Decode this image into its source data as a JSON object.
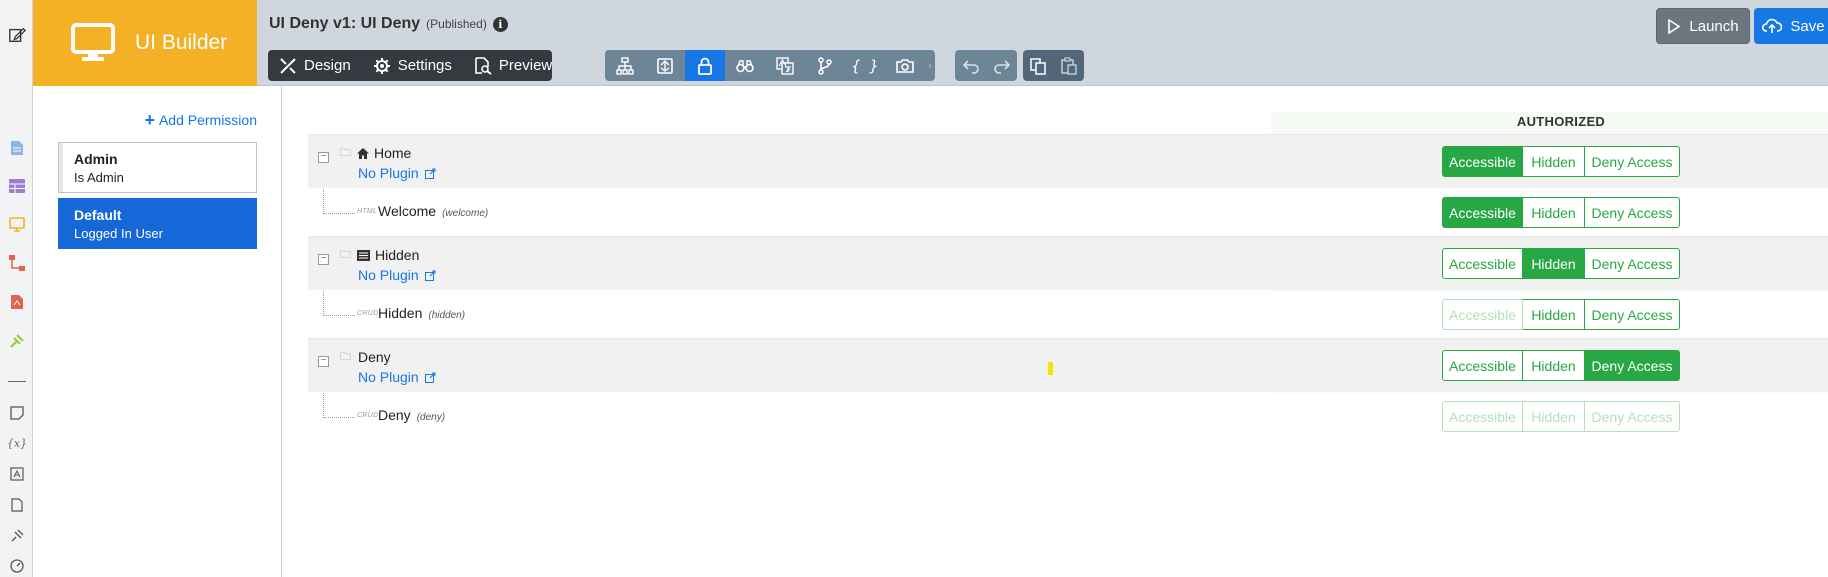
{
  "brand": {
    "title": "UI Builder"
  },
  "app": {
    "title": "UI Deny v1: UI Deny",
    "status": "(Published)"
  },
  "modes": [
    {
      "label": "Design",
      "icon": "design-icon"
    },
    {
      "label": "Settings",
      "icon": "gear-icon"
    },
    {
      "label": "Preview",
      "icon": "preview-icon"
    }
  ],
  "toolbar": {
    "tools": [
      "sitemap-icon",
      "upload-icon",
      "lock-icon",
      "binoculars-icon",
      "translate-icon",
      "branch-icon",
      "braces-icon",
      "camera-icon"
    ],
    "active_tool": "lock-icon"
  },
  "actions": {
    "launch": "Launch",
    "save": "Save"
  },
  "permissions": {
    "add_label": "Add Permission",
    "items": [
      {
        "name": "Admin",
        "sub": "Is Admin"
      },
      {
        "name": "Default",
        "sub": "Logged In User",
        "selected": true
      }
    ]
  },
  "main": {
    "column_header": "AUTHORIZED",
    "no_plugin": "No Plugin",
    "state_labels": {
      "accessible": "Accessible",
      "hidden": "Hidden",
      "deny": "Deny Access"
    },
    "rows": [
      {
        "kind": "page",
        "name": "Home",
        "icon": "home-icon",
        "state": "accessible"
      },
      {
        "kind": "component",
        "type": "HTML",
        "name": "Welcome",
        "id": "(welcome)",
        "state": "accessible"
      },
      {
        "kind": "page",
        "name": "Hidden",
        "icon": "list-icon",
        "state": "hidden"
      },
      {
        "kind": "component",
        "type": "CRUD",
        "name": "Hidden",
        "id": "(hidden)",
        "state": "hidden",
        "disabled": [
          "accessible"
        ]
      },
      {
        "kind": "page",
        "name": "Deny",
        "state": "deny"
      },
      {
        "kind": "component",
        "type": "CRUD",
        "name": "Deny",
        "id": "(deny)",
        "state": "none",
        "disabled": [
          "accessible",
          "hidden",
          "deny"
        ]
      }
    ]
  },
  "colors": {
    "brand": "#f4b126",
    "primary": "#1677e5",
    "success": "#28a745",
    "header": "#cfd6dd"
  }
}
